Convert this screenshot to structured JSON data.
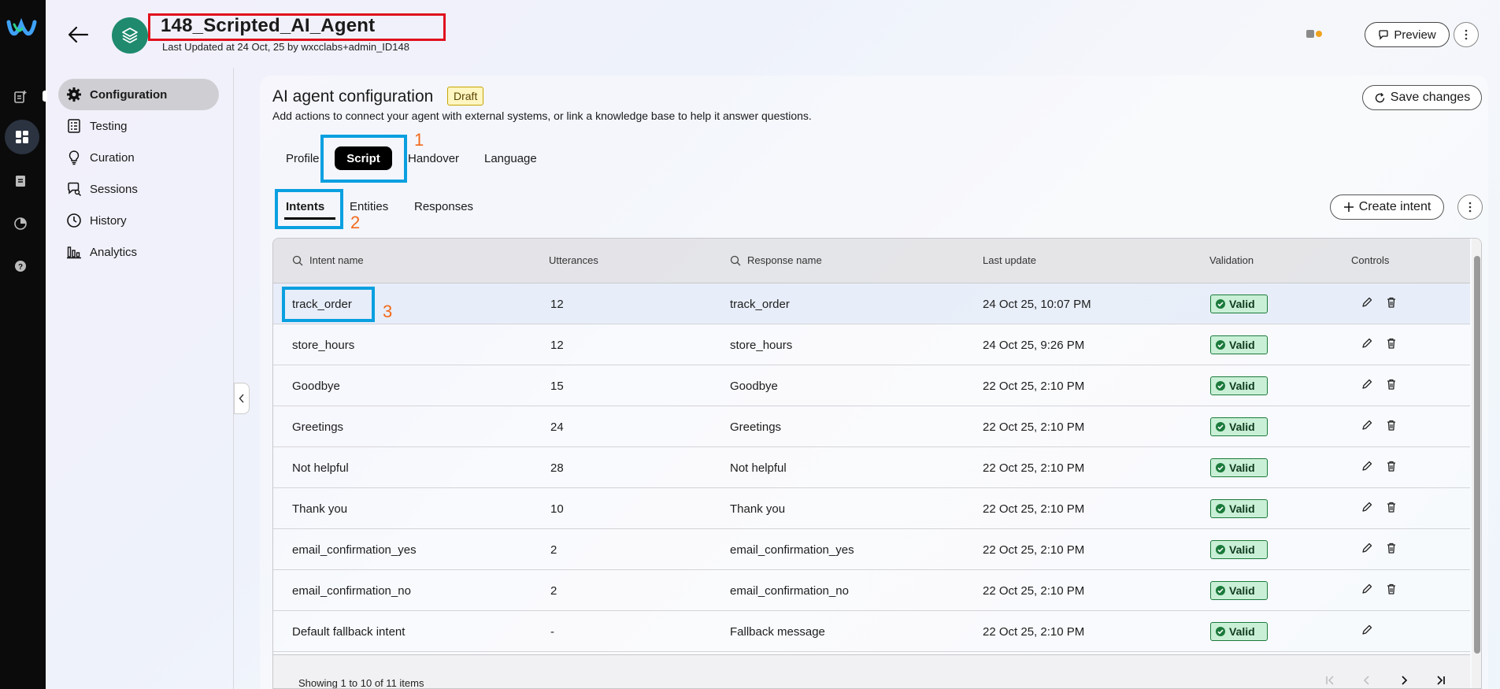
{
  "header": {
    "title": "148_Scripted_AI_Agent",
    "subtitle": "Last Updated at 24 Oct, 25 by wxcclabs+admin_ID148",
    "preview_label": "Preview"
  },
  "sidebar": {
    "items": [
      {
        "label": "Configuration",
        "icon": "gear-icon",
        "active": true
      },
      {
        "label": "Testing",
        "icon": "checklist-icon",
        "active": false
      },
      {
        "label": "Curation",
        "icon": "lightbulb-icon",
        "active": false
      },
      {
        "label": "Sessions",
        "icon": "chat-search-icon",
        "active": false
      },
      {
        "label": "History",
        "icon": "clock-icon",
        "active": false
      },
      {
        "label": "Analytics",
        "icon": "bar-chart-icon",
        "active": false
      }
    ]
  },
  "main": {
    "title": "AI agent configuration",
    "status_badge": "Draft",
    "description": "Add actions to connect your agent with external systems, or link a knowledge base to help it answer questions.",
    "save_label": "Save changes",
    "tabs": [
      "Profile",
      "Script",
      "Handover",
      "Language"
    ],
    "active_tab": "Script",
    "subtabs": [
      "Intents",
      "Entities",
      "Responses"
    ],
    "active_subtab": "Intents",
    "create_label": "Create intent",
    "annotations": [
      "1",
      "2",
      "3"
    ]
  },
  "table": {
    "columns": [
      "Intent name",
      "Utterances",
      "Response name",
      "Last update",
      "Validation",
      "Controls"
    ],
    "rows": [
      {
        "intent": "track_order",
        "utterances": "12",
        "response": "track_order",
        "updated": "24 Oct 25, 10:07 PM",
        "validation": "Valid",
        "deletable": true
      },
      {
        "intent": "store_hours",
        "utterances": "12",
        "response": "store_hours",
        "updated": "24 Oct 25, 9:26 PM",
        "validation": "Valid",
        "deletable": true
      },
      {
        "intent": "Goodbye",
        "utterances": "15",
        "response": "Goodbye",
        "updated": "22 Oct 25, 2:10 PM",
        "validation": "Valid",
        "deletable": true
      },
      {
        "intent": "Greetings",
        "utterances": "24",
        "response": "Greetings",
        "updated": "22 Oct 25, 2:10 PM",
        "validation": "Valid",
        "deletable": true
      },
      {
        "intent": "Not helpful",
        "utterances": "28",
        "response": "Not helpful",
        "updated": "22 Oct 25, 2:10 PM",
        "validation": "Valid",
        "deletable": true
      },
      {
        "intent": "Thank you",
        "utterances": "10",
        "response": "Thank you",
        "updated": "22 Oct 25, 2:10 PM",
        "validation": "Valid",
        "deletable": true
      },
      {
        "intent": "email_confirmation_yes",
        "utterances": "2",
        "response": "email_confirmation_yes",
        "updated": "22 Oct 25, 2:10 PM",
        "validation": "Valid",
        "deletable": true
      },
      {
        "intent": "email_confirmation_no",
        "utterances": "2",
        "response": "email_confirmation_no",
        "updated": "22 Oct 25, 2:10 PM",
        "validation": "Valid",
        "deletable": true
      },
      {
        "intent": "Default fallback intent",
        "utterances": "-",
        "response": "Fallback message",
        "updated": "22 Oct 25, 2:10 PM",
        "validation": "Valid",
        "deletable": false
      }
    ],
    "footer": "Showing 1 to 10 of 11 items"
  },
  "colors": {
    "title_highlight": "#e0121d",
    "annotation_box": "#0aa0e0",
    "annotation_number": "#f26a1b",
    "valid_bg": "#c9f0d6",
    "agent_icon_bg": "#1f8a6e"
  }
}
